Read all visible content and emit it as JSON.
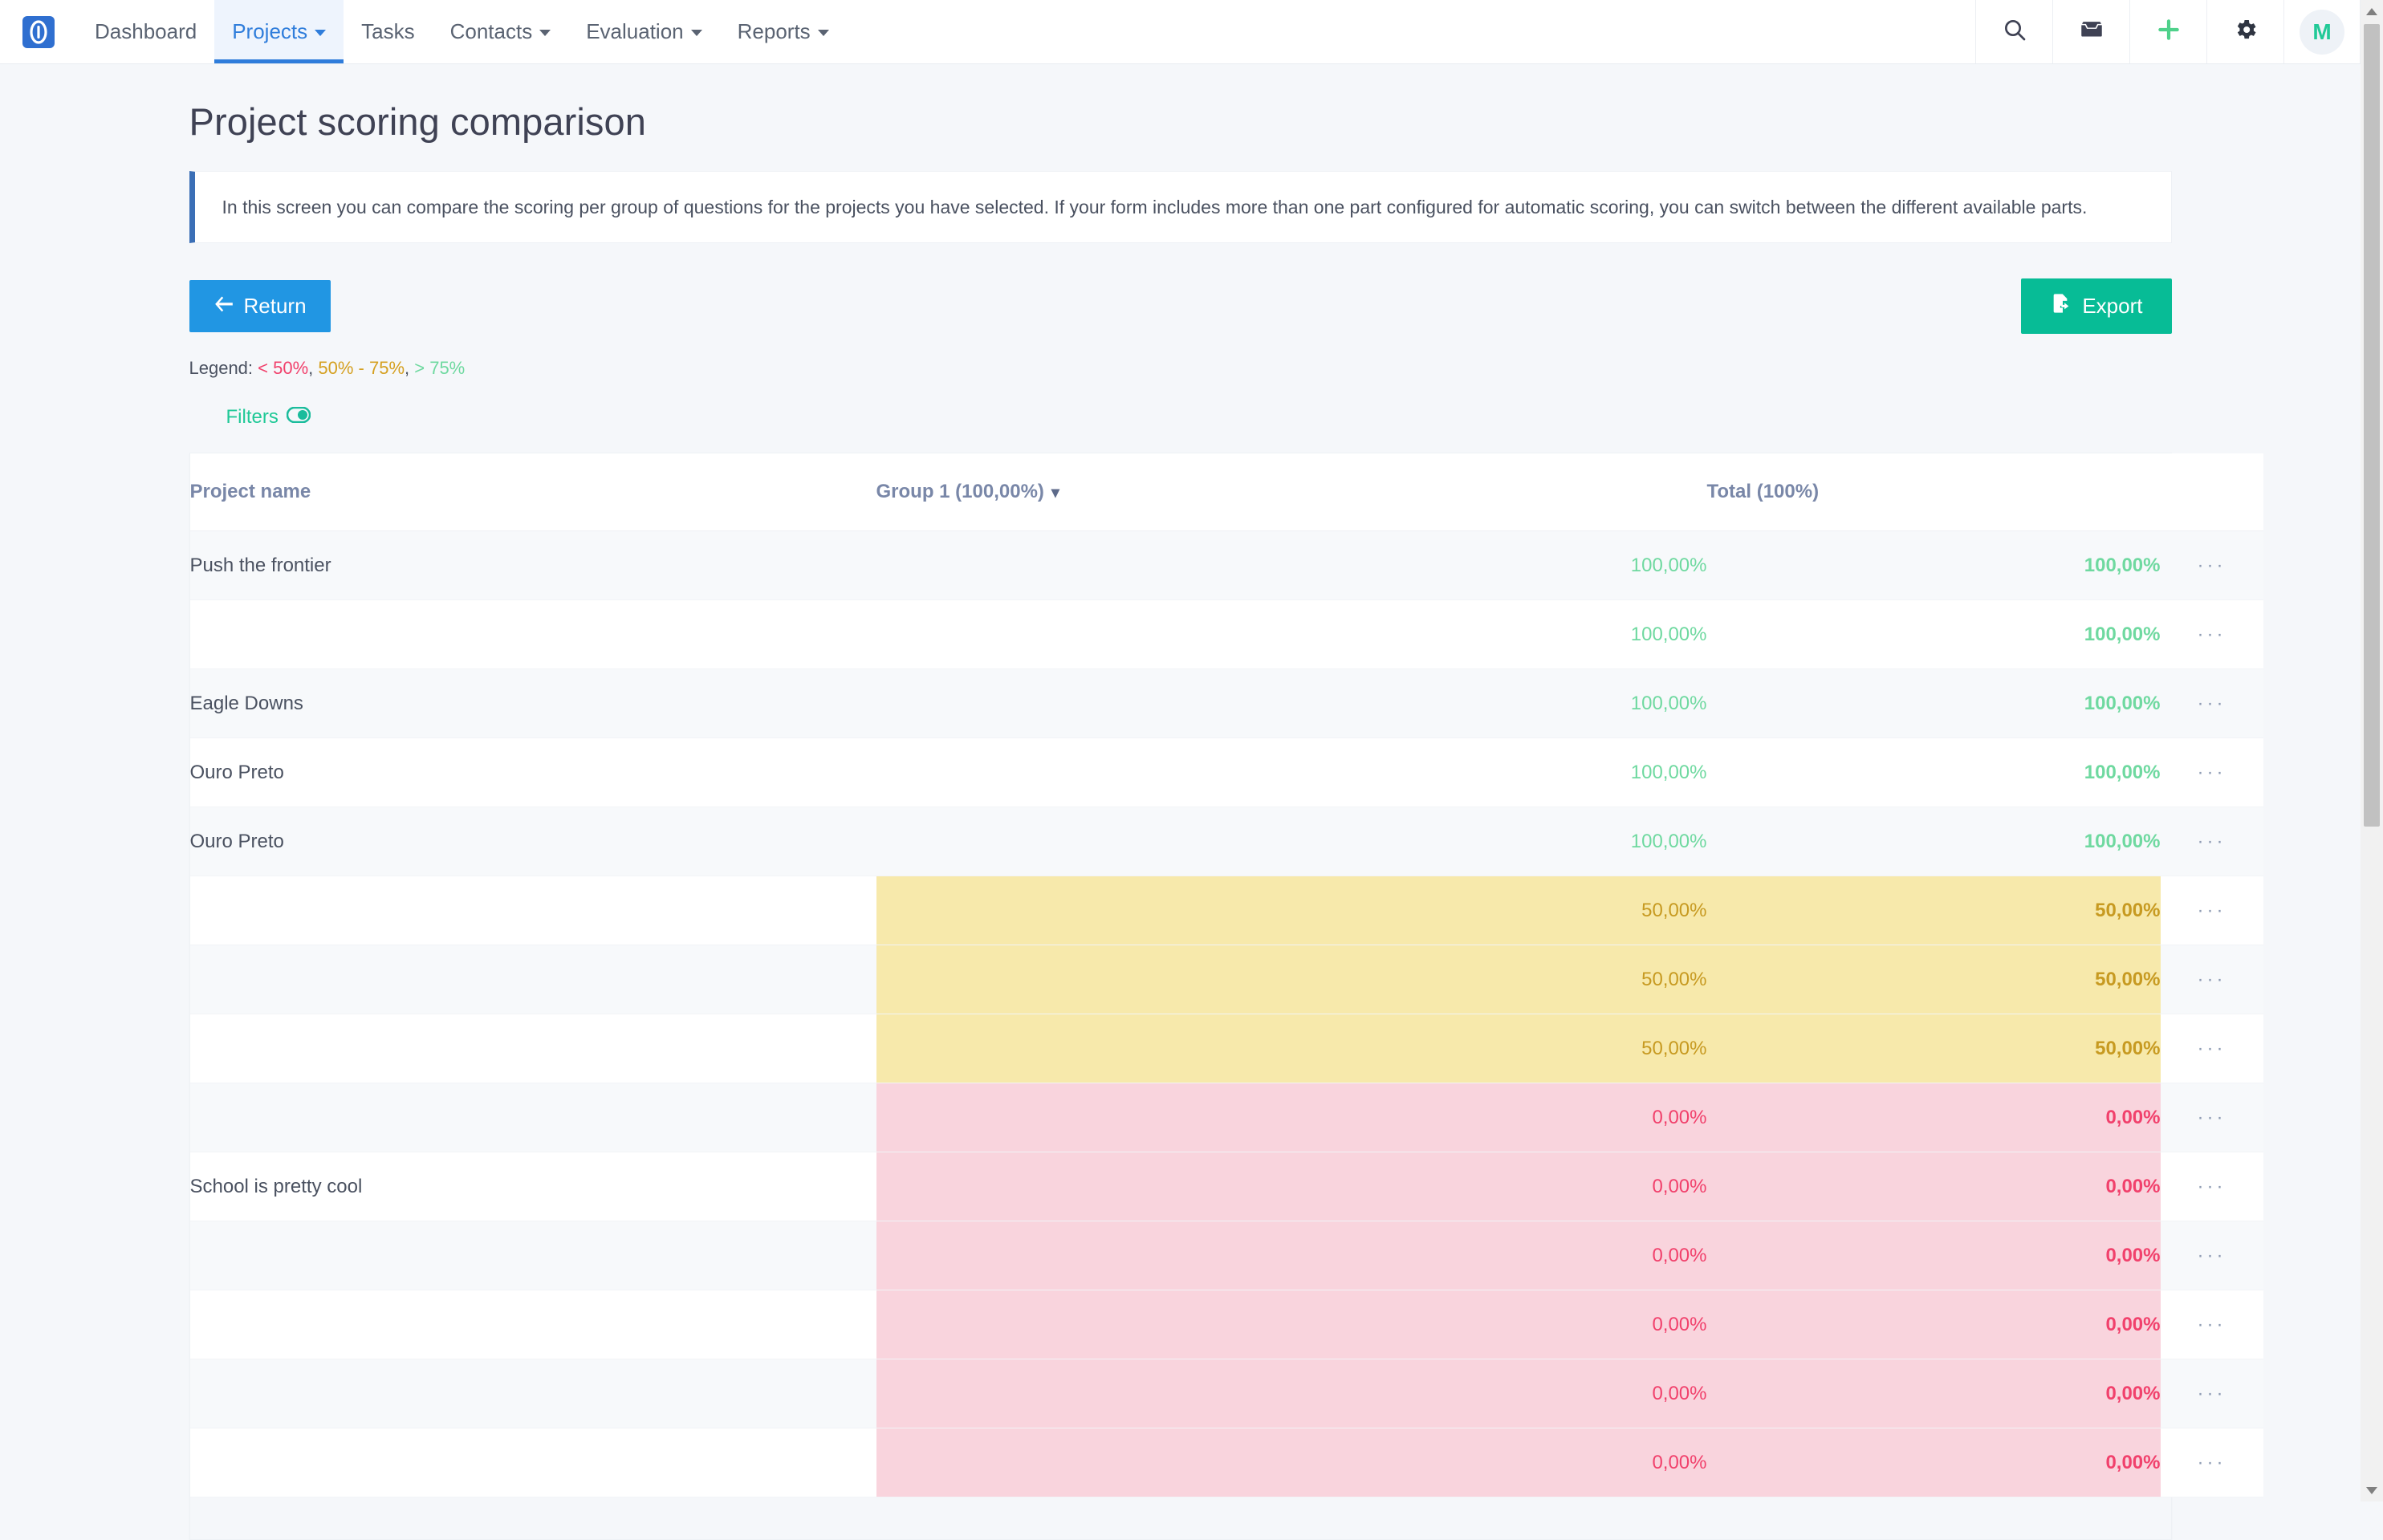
{
  "navbar": {
    "brand_icon": "app-logo-icon",
    "items": [
      {
        "label": "Dashboard",
        "has_caret": false,
        "active": false
      },
      {
        "label": "Projects",
        "has_caret": true,
        "active": true
      },
      {
        "label": "Tasks",
        "has_caret": false,
        "active": false
      },
      {
        "label": "Contacts",
        "has_caret": true,
        "active": false
      },
      {
        "label": "Evaluation",
        "has_caret": true,
        "active": false
      },
      {
        "label": "Reports",
        "has_caret": true,
        "active": false
      }
    ],
    "actions": [
      {
        "icon": "search-icon"
      },
      {
        "icon": "inbox-icon"
      },
      {
        "icon": "plus-icon"
      },
      {
        "icon": "gear-icon"
      }
    ],
    "avatar_initial": "M",
    "accent_blue": "#2f7ddb",
    "accent_green": "#20c997"
  },
  "page": {
    "title": "Project scoring comparison",
    "info_text": "In this screen you can compare the scoring per group of questions for the projects you have selected. If your form includes more than one part configured for automatic scoring, you can switch between the different available parts."
  },
  "toolbar": {
    "return_label": "Return",
    "return_icon": "arrow-left-icon",
    "export_label": "Export",
    "export_icon": "file-export-icon",
    "return_color": "#2196e3",
    "export_color": "#07bc96"
  },
  "legend": {
    "prefix": "Legend:",
    "low": "< 50%",
    "sep1": ", ",
    "mid": "50% - 75%",
    "sep2": ", ",
    "high": "> 75%",
    "low_color": "#f1416c",
    "mid_color": "#d5a021",
    "high_color": "#6fd9a0"
  },
  "filters": {
    "label": "Filters",
    "toggle_icon": "toggle-icon",
    "enabled": true
  },
  "table": {
    "columns": [
      {
        "key": "name",
        "label": "Project name",
        "sortable": false
      },
      {
        "key": "group",
        "label": "Group 1 (100,00%)",
        "has_dropdown": true,
        "chevron": "▾"
      },
      {
        "key": "total",
        "label": "Total (100%)",
        "has_dropdown": false
      },
      {
        "key": "menu",
        "label": "",
        "has_dropdown": false
      }
    ],
    "row_menu_icon": "ellipsis-icon",
    "row_menu_glyph": "···",
    "rows": [
      {
        "name": "Push the frontier",
        "group": "100,00%",
        "total": "100,00%",
        "level": "high"
      },
      {
        "name": "",
        "group": "100,00%",
        "total": "100,00%",
        "level": "high"
      },
      {
        "name": "Eagle Downs",
        "group": "100,00%",
        "total": "100,00%",
        "level": "high"
      },
      {
        "name": "Ouro Preto",
        "group": "100,00%",
        "total": "100,00%",
        "level": "high"
      },
      {
        "name": "Ouro Preto",
        "group": "100,00%",
        "total": "100,00%",
        "level": "high"
      },
      {
        "name": "",
        "group": "50,00%",
        "total": "50,00%",
        "level": "mid"
      },
      {
        "name": "",
        "group": "50,00%",
        "total": "50,00%",
        "level": "mid"
      },
      {
        "name": "",
        "group": "50,00%",
        "total": "50,00%",
        "level": "mid"
      },
      {
        "name": "",
        "group": "0,00%",
        "total": "0,00%",
        "level": "low"
      },
      {
        "name": "School is pretty cool",
        "group": "0,00%",
        "total": "0,00%",
        "level": "low"
      },
      {
        "name": "",
        "group": "0,00%",
        "total": "0,00%",
        "level": "low"
      },
      {
        "name": "",
        "group": "0,00%",
        "total": "0,00%",
        "level": "low"
      },
      {
        "name": "",
        "group": "0,00%",
        "total": "0,00%",
        "level": "low"
      },
      {
        "name": "",
        "group": "0,00%",
        "total": "0,00%",
        "level": "low"
      }
    ]
  },
  "scrollbar": {
    "up_arrow_icon": "scroll-up-arrow-icon",
    "down_arrow_icon": "scroll-down-arrow-icon",
    "thumb_icon": "scrollbar-thumb"
  }
}
